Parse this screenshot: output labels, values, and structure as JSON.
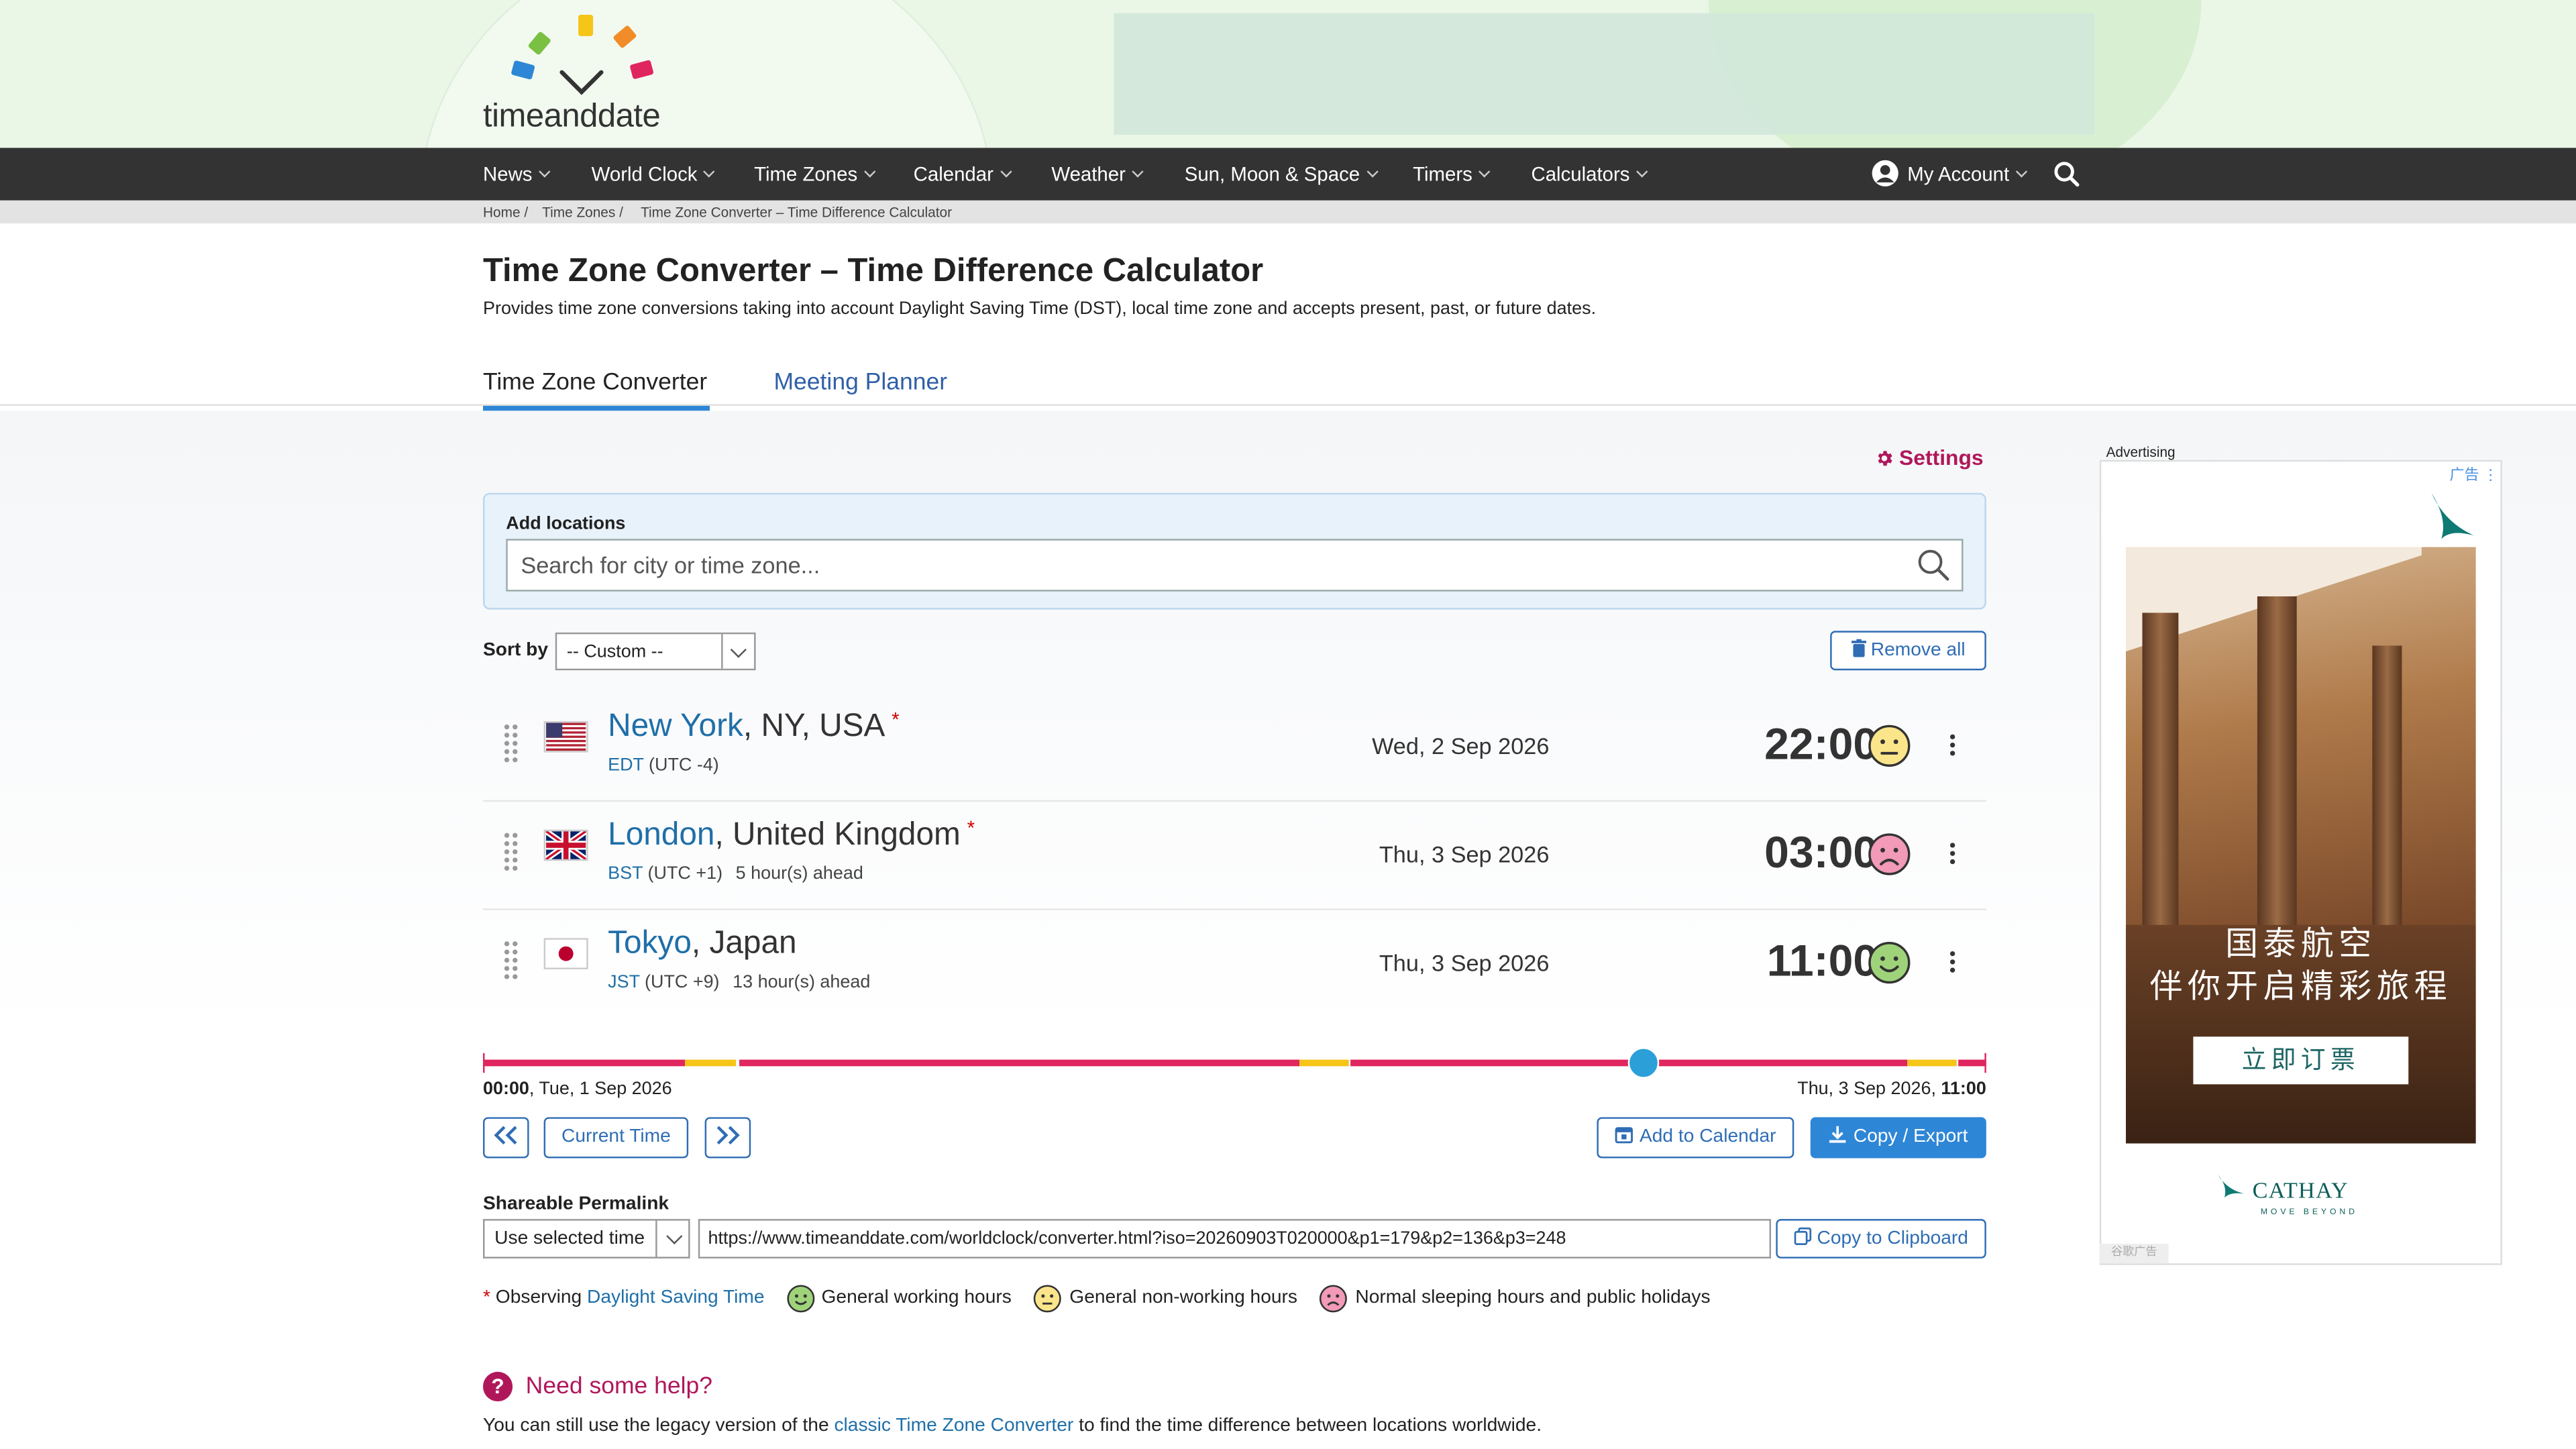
{
  "header": {
    "logo_text": "timeanddate"
  },
  "nav": {
    "items": [
      "News",
      "World Clock",
      "Time Zones",
      "Calendar",
      "Weather",
      "Sun, Moon & Space",
      "Timers",
      "Calculators"
    ],
    "account": "My Account"
  },
  "breadcrumb": [
    "Home /",
    "Time Zones /",
    "Time Zone Converter – Time Difference Calculator"
  ],
  "page": {
    "title": "Time Zone Converter – Time Difference Calculator",
    "subtitle": "Provides time zone conversions taking into account Daylight Saving Time (DST), local time zone and accepts present, past, or future dates."
  },
  "tabs": [
    "Time Zone Converter",
    "Meeting Planner"
  ],
  "settings_label": "Settings",
  "add_locations": {
    "label": "Add locations",
    "placeholder": "Search for city or time zone..."
  },
  "sort": {
    "label": "Sort by",
    "value": "-- Custom --"
  },
  "remove_all": "Remove all",
  "locations": [
    {
      "city": "New York",
      "region": ", NY, USA",
      "star": "*",
      "abbr": "EDT",
      "utc": " (UTC -4)",
      "diff": "",
      "date": "Wed, 2 Sep 2026",
      "time": "22:00",
      "status": "non-working"
    },
    {
      "city": "London",
      "region": ", United Kingdom",
      "star": "*",
      "abbr": "BST",
      "utc": " (UTC +1)",
      "diff": "5 hour(s) ahead",
      "date": "Thu, 3 Sep 2026",
      "time": "03:00",
      "status": "sleeping"
    },
    {
      "city": "Tokyo",
      "region": ", Japan",
      "star": "",
      "abbr": "JST",
      "utc": " (UTC +9)",
      "diff": "13 hour(s) ahead",
      "date": "Thu, 3 Sep 2026",
      "time": "11:00",
      "status": "working"
    }
  ],
  "timeline": {
    "start_time": "00:00",
    "start_date": ", Tue, 1 Sep 2026",
    "end_date": "Thu, 3 Sep 2026, ",
    "end_time": "11:00",
    "selected_fraction": 0.772,
    "colors": {
      "sleeping": "#e0265f",
      "non_working": "#f5c518",
      "handle": "#2a9fd8"
    }
  },
  "buttons": {
    "current_time": "Current Time",
    "add_to_calendar": "Add to Calendar",
    "copy_export": "Copy / Export",
    "copy_clipboard": "Copy to Clipboard"
  },
  "permalink": {
    "label": "Shareable Permalink",
    "mode": "Use selected time",
    "url": "https://www.timeanddate.com/worldclock/converter.html?iso=20260903T020000&p1=179&p2=136&p3=248"
  },
  "legend": {
    "dst_prefix": "Observing ",
    "dst_link": "Daylight Saving Time",
    "working": "General working hours",
    "non_working": "General non-working hours",
    "sleeping": "Normal sleeping hours and public holidays"
  },
  "help": {
    "title": "Need some help?",
    "text_before": "You can still use the legacy version of the ",
    "link": "classic Time Zone Converter",
    "text_after": " to find the time difference between locations worldwide."
  },
  "ad": {
    "label": "Advertising",
    "tag": "广告",
    "headline_1": "国泰航空",
    "headline_2": "伴你开启精彩旅程",
    "cta": "立即订票",
    "brand": "CATHAY",
    "slogan": "MOVE BEYOND",
    "footer": "谷歌广告"
  },
  "colors": {
    "nav_bg": "#333333",
    "accent": "#2e86d6",
    "link": "#1f6fa8",
    "brand_magenta": "#b0175b"
  }
}
